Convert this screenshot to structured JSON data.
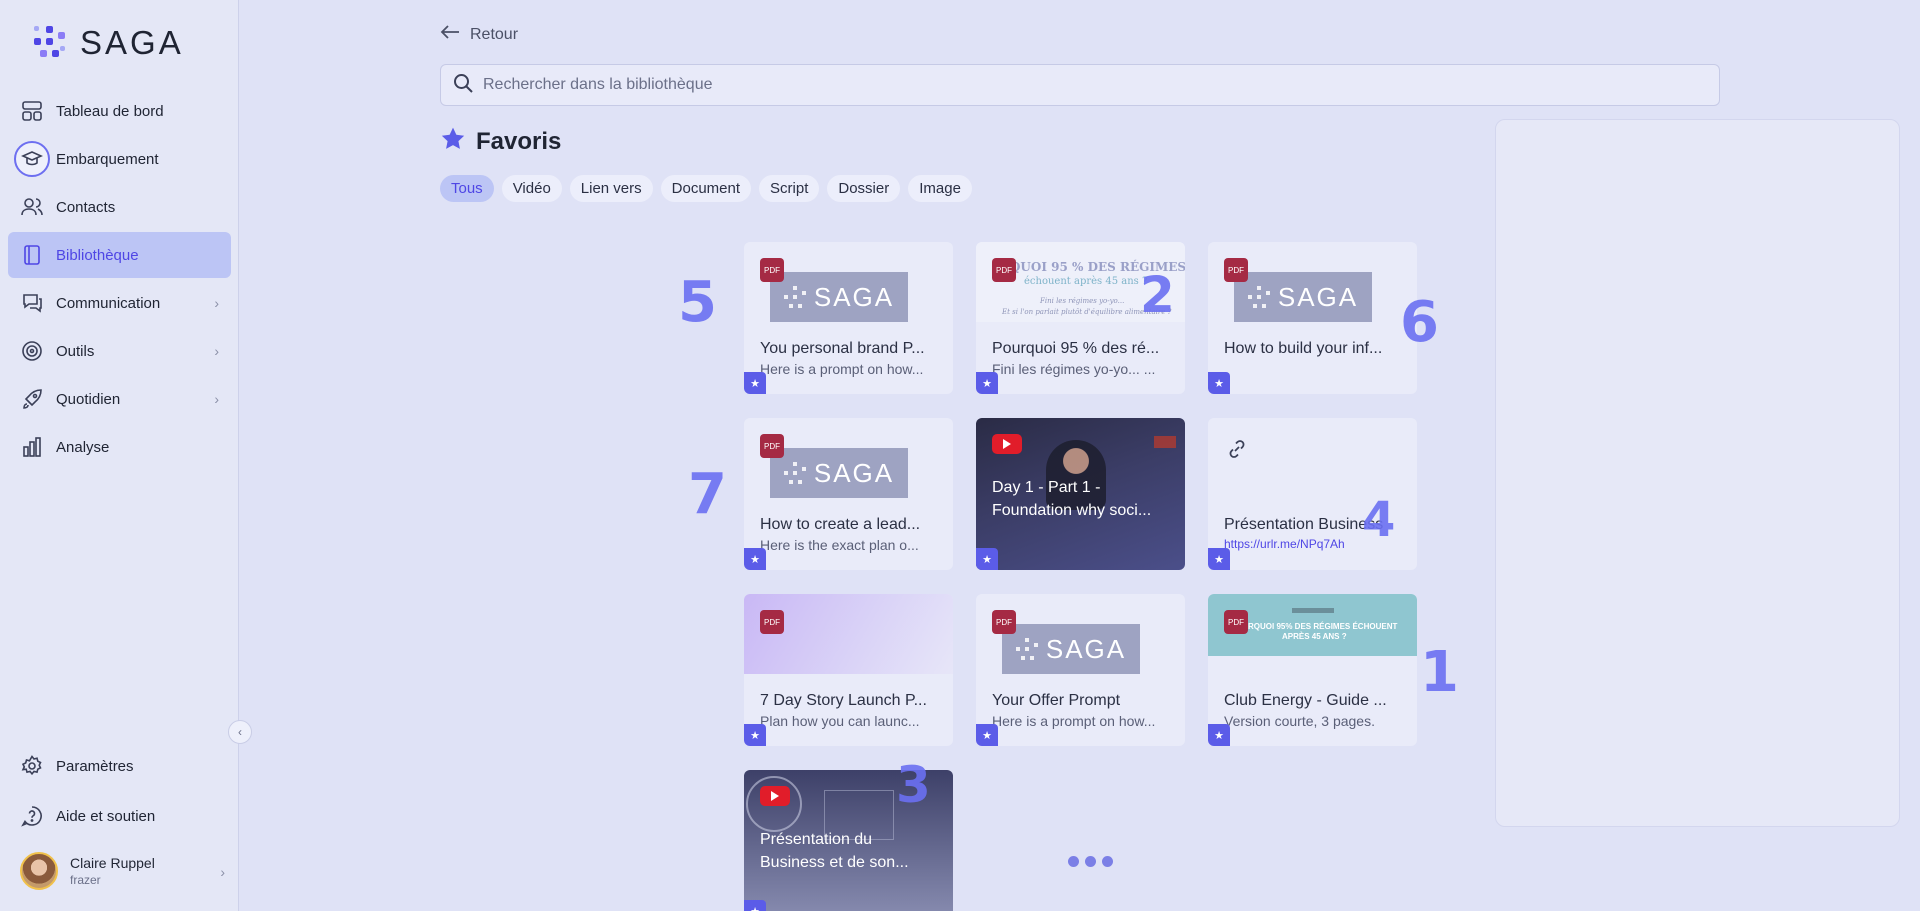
{
  "brand": {
    "name": "SAGA",
    "accent": "#4f46e5"
  },
  "sidebar": {
    "items": [
      {
        "label": "Tableau de bord",
        "icon": "dashboard-icon"
      },
      {
        "label": "Embarquement",
        "icon": "graduation-cap-icon"
      },
      {
        "label": "Contacts",
        "icon": "users-icon"
      },
      {
        "label": "Bibliothèque",
        "icon": "book-icon",
        "active": true
      },
      {
        "label": "Communication",
        "icon": "chat-icon",
        "submenu": true
      },
      {
        "label": "Outils",
        "icon": "target-icon",
        "submenu": true
      },
      {
        "label": "Quotidien",
        "icon": "rocket-icon",
        "submenu": true
      },
      {
        "label": "Analyse",
        "icon": "bar-chart-icon"
      }
    ],
    "bottom": [
      {
        "label": "Paramètres",
        "icon": "gear-icon"
      },
      {
        "label": "Aide et soutien",
        "icon": "help-icon"
      }
    ],
    "user": {
      "name": "Claire Ruppel",
      "handle": "frazer"
    }
  },
  "main": {
    "back_label": "Retour",
    "search_placeholder": "Rechercher dans la bibliothèque",
    "title": "Favoris",
    "filters": [
      "Tous",
      "Vidéo",
      "Lien vers",
      "Document",
      "Script",
      "Dossier",
      "Image"
    ],
    "active_filter": "Tous"
  },
  "cards": [
    {
      "type": "pdf",
      "thumb": "saga",
      "title": "You personal brand P...",
      "desc": "Here is a prompt on how..."
    },
    {
      "type": "pdf",
      "thumb": "article",
      "thumb_line1": "RQUOI 95 % DES RÉGIMES",
      "thumb_line2": "échouent après 45 ans ?",
      "thumb_line3": "Fini les régimes yo-yo...",
      "thumb_line4": "Et si l'on parlait plutôt d'équilibre alimentaire ?",
      "title": "Pourquoi 95 % des ré...",
      "desc": "Fini les régimes yo-yo... ..."
    },
    {
      "type": "pdf",
      "thumb": "saga",
      "title": "How to build your inf...",
      "desc": ""
    },
    {
      "type": "pdf",
      "thumb": "saga",
      "title": "How to create a lead...",
      "desc": "Here is the exact plan o..."
    },
    {
      "type": "video",
      "title_line1": "Day 1 - Part 1 -",
      "title_line2": "Foundation why soci..."
    },
    {
      "type": "link",
      "title": "Présentation Business",
      "link": "https://urlr.me/NPq7Ah"
    },
    {
      "type": "pdf",
      "thumb": "gradient",
      "title": "7 Day Story Launch P...",
      "desc": "Plan how you can launc..."
    },
    {
      "type": "pdf",
      "thumb": "saga",
      "title": "Your Offer Prompt",
      "desc": "Here is a prompt on how..."
    },
    {
      "type": "pdf",
      "thumb": "teal",
      "thumb_line1": "RQUOI 95% DES RÉGIMES ÉCHOUENT",
      "thumb_line2": "APRÈS 45 ANS ?",
      "title": "Club Energy - Guide ...",
      "desc": "Version courte, 3 pages."
    },
    {
      "type": "video",
      "title_line1": "Présentation du",
      "title_line2": "Business et de son..."
    }
  ],
  "annotations": [
    "5",
    "2",
    "6",
    "7",
    "4",
    "1",
    "3"
  ],
  "pdf_label": "PDF",
  "colors": {
    "sidebar_active": "#bcc5f5",
    "star_badge": "#5b5ce8",
    "pdf_badge": "#a52a44",
    "youtube": "#e11d2a"
  }
}
